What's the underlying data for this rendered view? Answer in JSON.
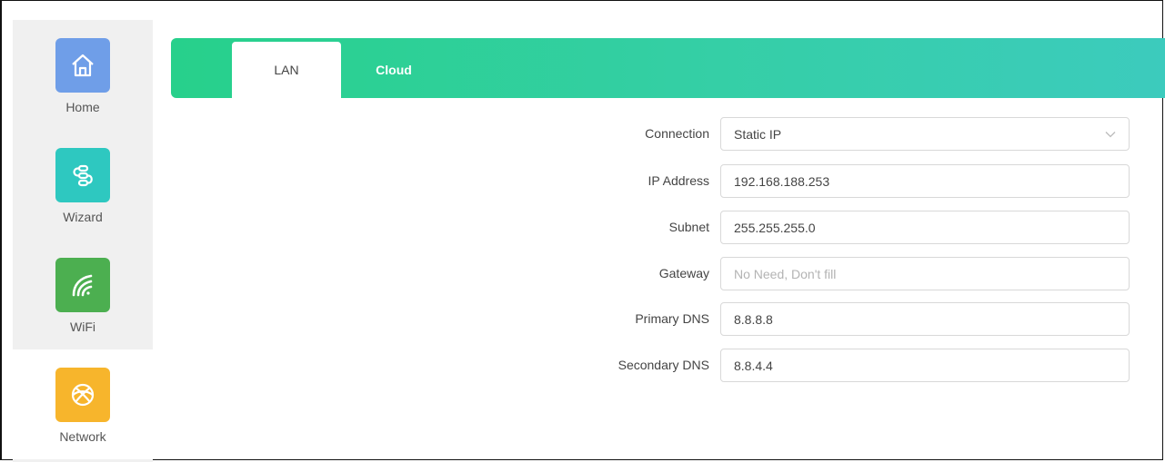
{
  "sidebar": {
    "items": [
      {
        "label": "Home",
        "icon": "home-icon",
        "color": "#6f9ee8"
      },
      {
        "label": "Wizard",
        "icon": "wizard-icon",
        "color": "#2ec8c0"
      },
      {
        "label": "WiFi",
        "icon": "wifi-icon",
        "color": "#4caf50"
      },
      {
        "label": "Network",
        "icon": "globe-icon",
        "color": "#f7b52c",
        "active": true
      }
    ]
  },
  "tabs": [
    {
      "label": "LAN",
      "active": true
    },
    {
      "label": "Cloud",
      "active": false
    }
  ],
  "accent": "#2fcf9e",
  "form": {
    "connection": {
      "label": "Connection",
      "value": "Static IP"
    },
    "ip_address": {
      "label": "IP Address",
      "value": "192.168.188.253"
    },
    "subnet": {
      "label": "Subnet",
      "value": "255.255.255.0"
    },
    "gateway": {
      "label": "Gateway",
      "value": "",
      "placeholder": "No Need, Don't fill"
    },
    "primary_dns": {
      "label": "Primary DNS",
      "value": "8.8.8.8"
    },
    "secondary_dns": {
      "label": "Secondary DNS",
      "value": "8.8.4.4"
    }
  }
}
